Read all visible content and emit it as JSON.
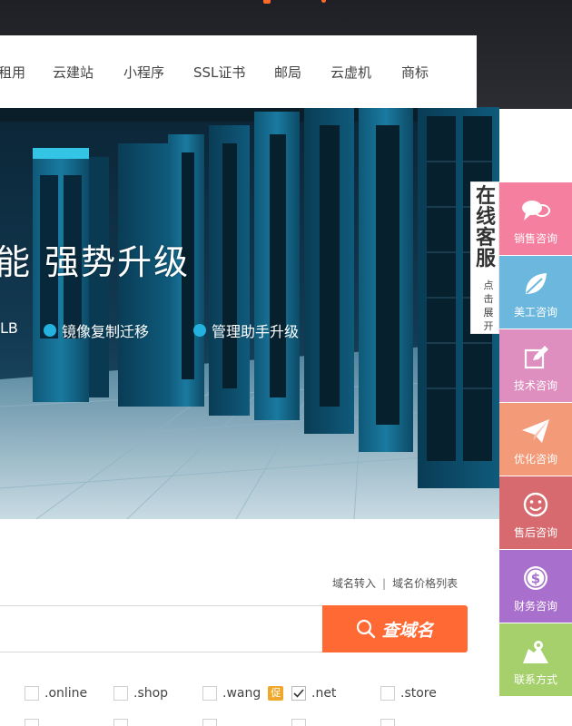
{
  "nav": {
    "items": [
      "租用",
      "云建站",
      "小程序",
      "SSL证书",
      "邮局",
      "云虚机",
      "商标"
    ]
  },
  "banner": {
    "headline": "能  强势升级",
    "features": [
      "LB",
      "镜像复制迁移",
      "管理助手升级"
    ]
  },
  "domain": {
    "transfer_link": "域名转入",
    "separator": "|",
    "price_link": "域名价格列表",
    "search_placeholder": "",
    "search_button": "查域名",
    "tlds": [
      {
        "label": ".online",
        "checked": false
      },
      {
        "label": ".shop",
        "checked": false
      },
      {
        "label": ".wang",
        "checked": false,
        "badge": "促"
      },
      {
        "label": ".net",
        "checked": true
      },
      {
        "label": ".store",
        "checked": false
      }
    ]
  },
  "online_service": {
    "title": "在线客服",
    "hint": "点击展开"
  },
  "side_bar": {
    "items": [
      {
        "label": "销售咨询",
        "icon": "chat-bubbles-icon",
        "color": "#f47f9e"
      },
      {
        "label": "美工咨询",
        "icon": "leaf-icon",
        "color": "#6cb7dd"
      },
      {
        "label": "技术咨询",
        "icon": "edit-icon",
        "color": "#de8fbf"
      },
      {
        "label": "优化咨询",
        "icon": "paper-plane-icon",
        "color": "#f39a78"
      },
      {
        "label": "售后咨询",
        "icon": "smile-icon",
        "color": "#d76a6e"
      },
      {
        "label": "财务咨询",
        "icon": "dollar-coin-icon",
        "color": "#a86fcc"
      },
      {
        "label": "联系方式",
        "icon": "map-icon",
        "color": "#a5d06c"
      }
    ]
  },
  "colors": {
    "accent": "#ff6a34",
    "feature_dot": "#23b2e0",
    "top_band": "#2a2b2f"
  }
}
